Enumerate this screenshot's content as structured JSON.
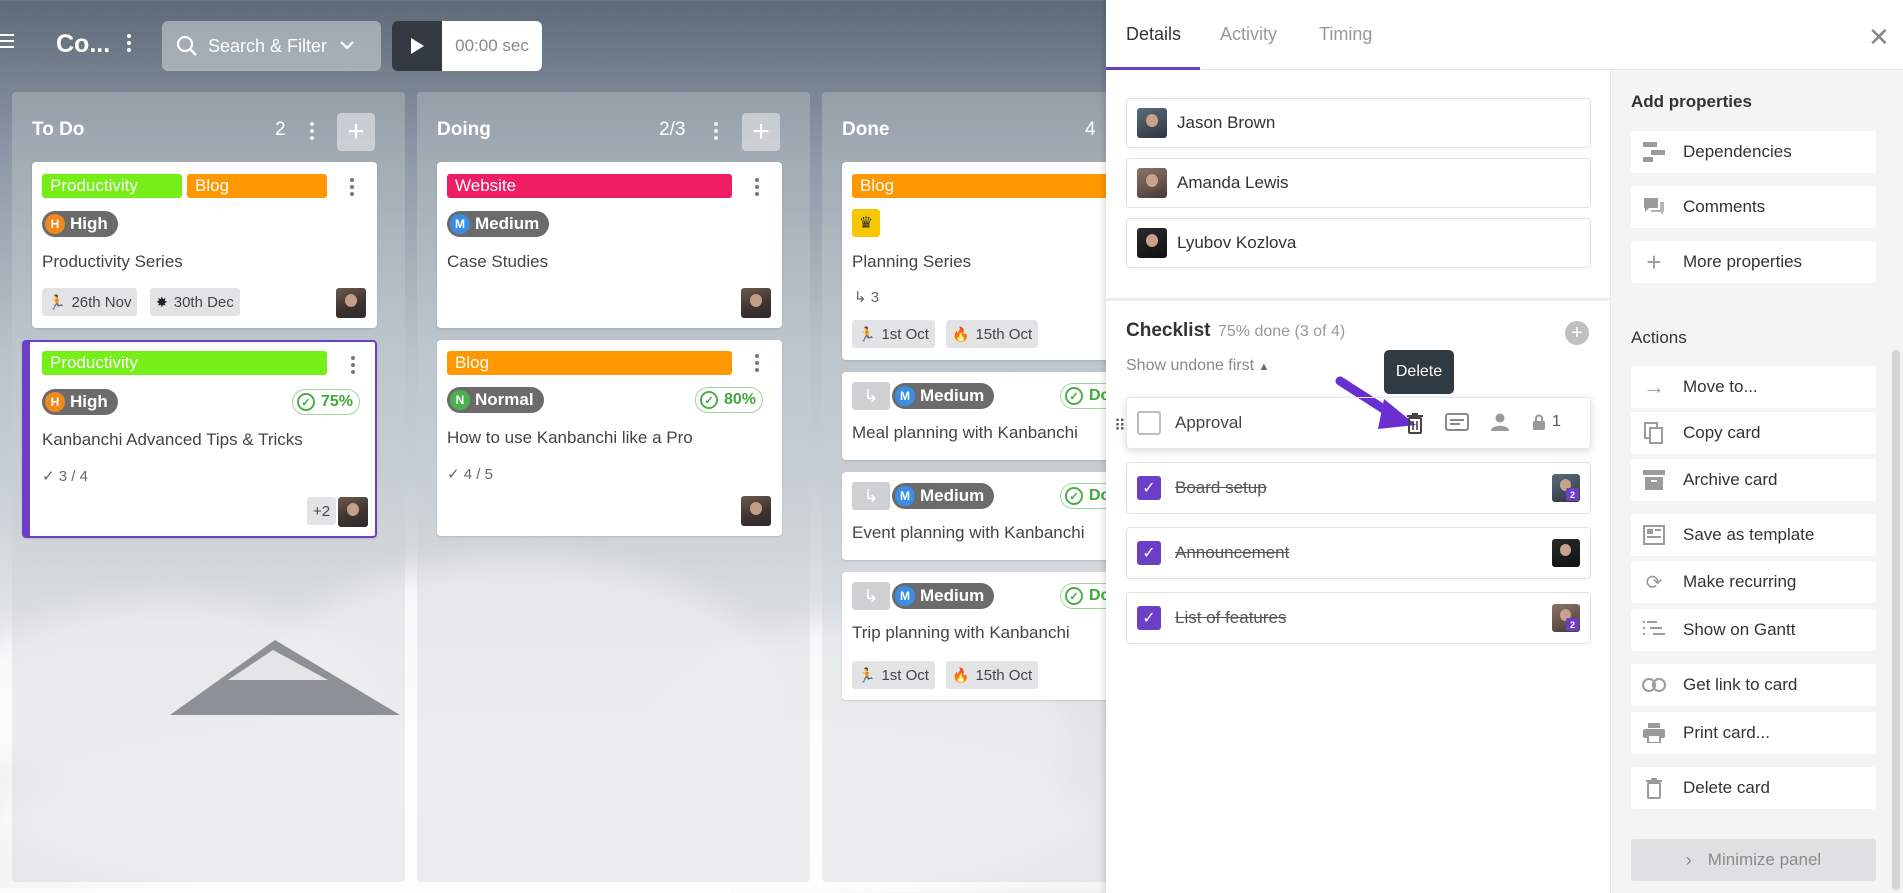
{
  "topbar": {
    "board_title": "Co...",
    "search_label": "Search & Filter",
    "timer": "00:00 sec"
  },
  "columns": [
    {
      "title": "To Do",
      "count": "2"
    },
    {
      "title": "Doing",
      "count": "2/3"
    },
    {
      "title": "Done",
      "count": "4"
    }
  ],
  "todo_cards": [
    {
      "tags": [
        "Productivity",
        "Blog"
      ],
      "priority_letter": "H",
      "priority": "High",
      "title": "Productivity Series",
      "start": "26th Nov",
      "due": "30th Dec"
    },
    {
      "tags": [
        "Productivity"
      ],
      "priority_letter": "H",
      "priority": "High",
      "progress": "75%",
      "title": "Kanbanchi Advanced Tips & Tricks",
      "checks": "3 / 4",
      "extra_members": "+2"
    }
  ],
  "doing_cards": [
    {
      "tags": [
        "Website"
      ],
      "priority_letter": "M",
      "priority": "Medium",
      "title": "Case Studies"
    },
    {
      "tags": [
        "Blog"
      ],
      "priority_letter": "N",
      "priority": "Normal",
      "progress": "80%",
      "title": "How to use Kanbanchi like a Pro",
      "checks": "4 / 5"
    }
  ],
  "done_cards": [
    {
      "tags": [
        "Blog"
      ],
      "title": "Planning Series",
      "subcards": "3",
      "start": "1st Oct",
      "due": "15th Oct"
    },
    {
      "priority_letter": "M",
      "priority": "Medium",
      "status": "Do",
      "title": "Meal planning with Kanbanchi"
    },
    {
      "priority_letter": "M",
      "priority": "Medium",
      "status": "Do",
      "title": "Event planning with Kanbanchi"
    },
    {
      "priority_letter": "M",
      "priority": "Medium",
      "status": "Do",
      "title": "Trip planning with Kanbanchi",
      "start": "1st Oct",
      "due": "15th Oct"
    }
  ],
  "panel": {
    "tabs": [
      "Details",
      "Activity",
      "Timing"
    ],
    "members": [
      "Jason Brown",
      "Amanda Lewis",
      "Lyubov Kozlova"
    ],
    "checklist": {
      "title": "Checklist",
      "summary": "75% done (3 of 4)",
      "sort_label": "Show undone first",
      "tooltip": "Delete",
      "items": [
        {
          "label": "Approval",
          "done": false,
          "lock_count": "1"
        },
        {
          "label": "Board setup",
          "done": true,
          "badge": "2"
        },
        {
          "label": "Announcement",
          "done": true
        },
        {
          "label": "List of features",
          "done": true,
          "badge": "2"
        }
      ]
    },
    "add_properties": {
      "heading": "Add properties",
      "items": [
        "Dependencies",
        "Comments",
        "More properties"
      ]
    },
    "actions": {
      "heading": "Actions",
      "items": [
        "Move to...",
        "Copy card",
        "Archive card",
        "Save as template",
        "Make recurring",
        "Show on Gantt",
        "Get link to card",
        "Print card...",
        "Delete card"
      ]
    },
    "minimize_label": "Minimize panel"
  },
  "colors": {
    "accent": "#6c3fc7",
    "productivity": "#76ee18",
    "blog": "#ff9800",
    "website": "#ee1d64",
    "high": "#f08a1c",
    "medium": "#3a8ee6",
    "normal": "#4caf50",
    "done_green": "#4cae4a"
  }
}
